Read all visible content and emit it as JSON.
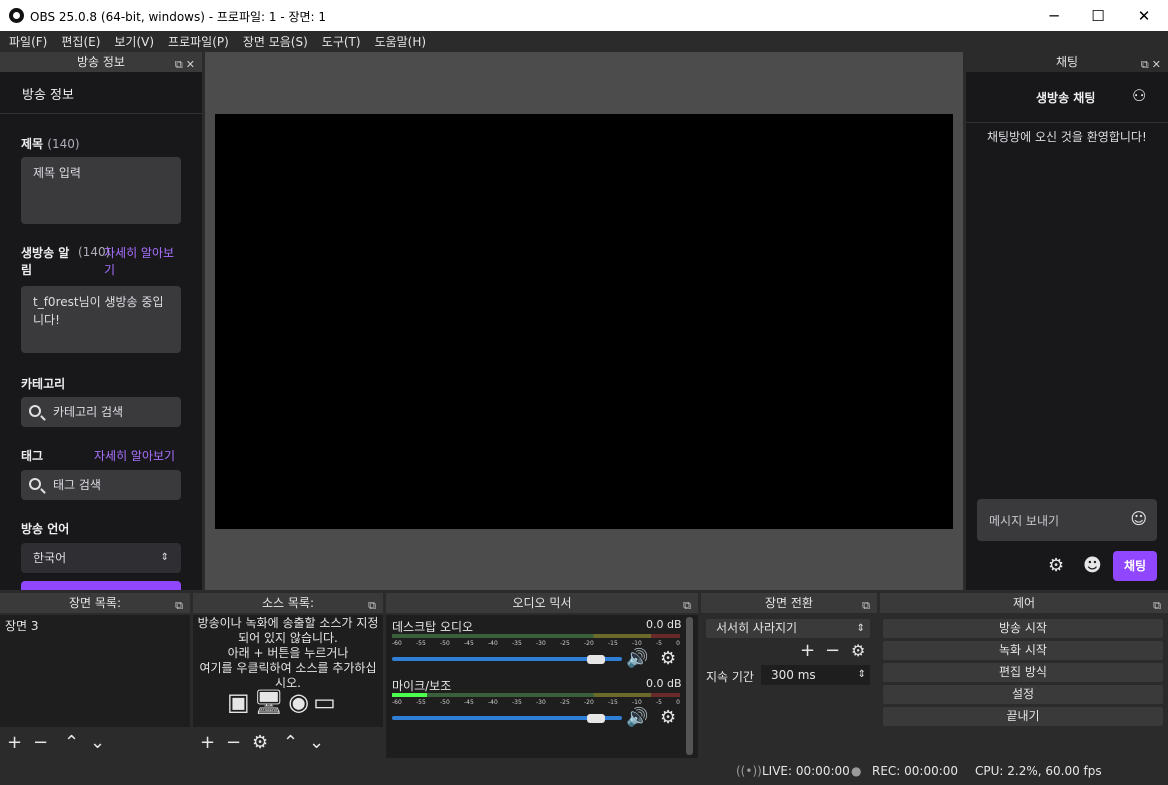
{
  "window": {
    "title": "OBS 25.0.8 (64-bit, windows) - 프로파일: 1 - 장면: 1",
    "minimize_glyph": "─",
    "maximize_glyph": "☐",
    "close_glyph": "✕"
  },
  "menu": [
    "파일(F)",
    "편집(E)",
    "보기(V)",
    "프로파일(P)",
    "장면 모음(S)",
    "도구(T)",
    "도움말(H)"
  ],
  "stream_info": {
    "dock_title": "방송 정보",
    "heading": "방송 정보",
    "title_label": "제목",
    "title_count": "(140)",
    "title_placeholder": "제목 입력",
    "notify_label": "생방송 알림",
    "notify_count": "(140)",
    "notify_link": "자세히 알아보기",
    "notify_value": "t_f0rest님이 생방송 중입니다!",
    "category_label": "카테고리",
    "category_placeholder": "카테고리 검색",
    "tags_label": "태그",
    "tags_link": "자세히 알아보기",
    "tags_placeholder": "태그 검색",
    "lang_label": "방송 언어",
    "lang_value": "한국어",
    "accent_color": "#9147ff"
  },
  "chat": {
    "dock_title": "채팅",
    "header": "생방송 채팅",
    "welcome": "채팅방에 오신 것을 환영합니다!",
    "input_placeholder": "메시지 보내기",
    "send_label": "채팅"
  },
  "scenes": {
    "title": "장면 목록:",
    "items": [
      "장면 3"
    ]
  },
  "sources": {
    "title": "소스 목록:",
    "empty_text": [
      "방송이나 녹화에 송출할 소스가 지정되어 있지 않습니다.",
      "아래 + 버튼을 누르거나",
      "여기를 우클릭하여 소스를 추가하십시오."
    ]
  },
  "mixer": {
    "title": "오디오 믹서",
    "ticks": [
      "-60",
      "-55",
      "-50",
      "-45",
      "-40",
      "-35",
      "-30",
      "-25",
      "-20",
      "-15",
      "-10",
      "-5",
      "0"
    ],
    "channels": [
      {
        "name": "데스크탑 오디오",
        "db": "0.0 dB",
        "level": 0.0,
        "volume": 0.92
      },
      {
        "name": "마이크/보조",
        "db": "0.0 dB",
        "level": 0.12,
        "volume": 0.92
      }
    ]
  },
  "transitions": {
    "title": "장면 전환",
    "type": "서서히 사라지기",
    "duration_label": "지속 기간",
    "duration_value": "300 ms"
  },
  "controls": {
    "title": "제어",
    "buttons": [
      "방송 시작",
      "녹화 시작",
      "편집 방식",
      "설정",
      "끝내기"
    ]
  },
  "status": {
    "live": "LIVE: 00:00:00",
    "rec": "REC: 00:00:00",
    "cpu": "CPU: 2.2%, 60.00 fps"
  }
}
